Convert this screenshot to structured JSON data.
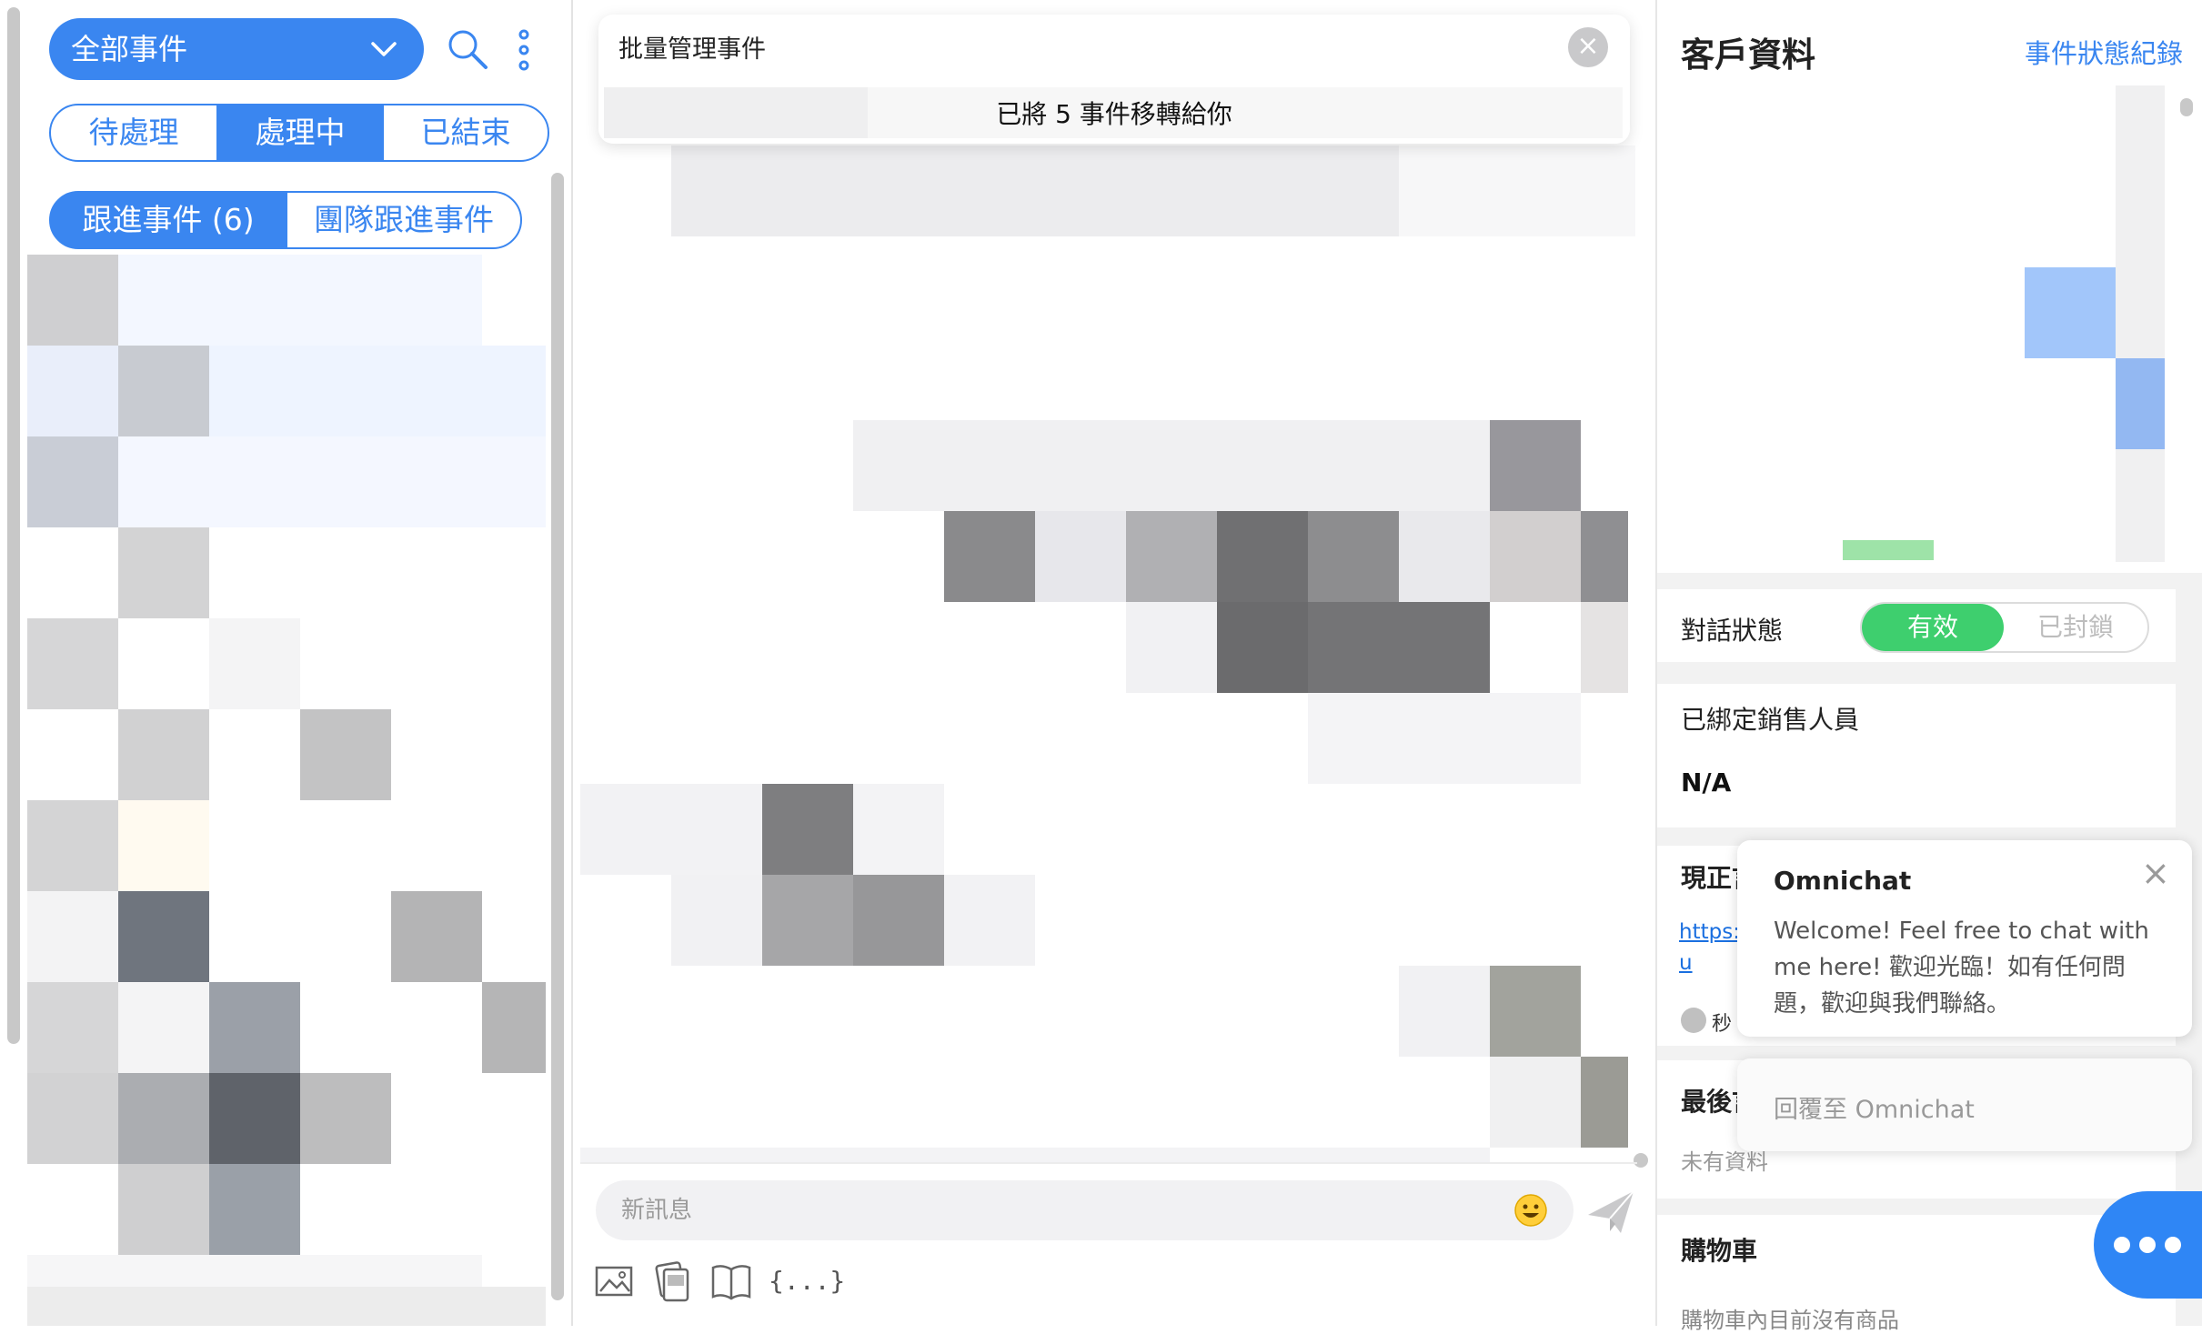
{
  "left": {
    "dropdown_label": "全部事件",
    "status_tabs": [
      "待處理",
      "處理中",
      "已結束"
    ],
    "follow_tabs": [
      "跟進事件 (6)",
      "團隊跟進事件"
    ]
  },
  "batch": {
    "title": "批量管理事件",
    "message": "已將 5 事件移轉給你"
  },
  "composer": {
    "placeholder": "新訊息",
    "variable_label": "{...}"
  },
  "right": {
    "title": "客戶資料",
    "status_log_link": "事件狀態紀錄",
    "conversation_status_label": "對話狀態",
    "status_valid": "有效",
    "status_blocked": "已封鎖",
    "sales_label": "已綁定銷售人員",
    "sales_value": "N/A",
    "current_label": "現正言",
    "current_link": "https:/",
    "current_link_tail": "u",
    "current_time": "秒",
    "last_label": "最後言",
    "last_value": "未有資料",
    "cart_label": "購物車",
    "cart_empty": "購物車內目前沒有商品"
  },
  "omnichat": {
    "title": "Omnichat",
    "welcome": "Welcome! Feel free to chat with me here! 歡迎光臨！如有任何問題，歡迎與我們聯絡。",
    "reply_placeholder": "回覆至 Omnichat"
  },
  "colors": {
    "accent": "#3a86f0",
    "valid_green": "#3ecf6e",
    "launcher_blue": "#2f86f5"
  },
  "icons": {
    "dropdown": "chevron-down-icon",
    "search": "search-icon",
    "more": "more-vertical-icon",
    "close": "close-icon",
    "emoji": "emoji-icon",
    "send": "send-icon",
    "image": "image-icon",
    "card": "card-icon",
    "book": "book-icon",
    "launcher": "more-horizontal-icon"
  }
}
